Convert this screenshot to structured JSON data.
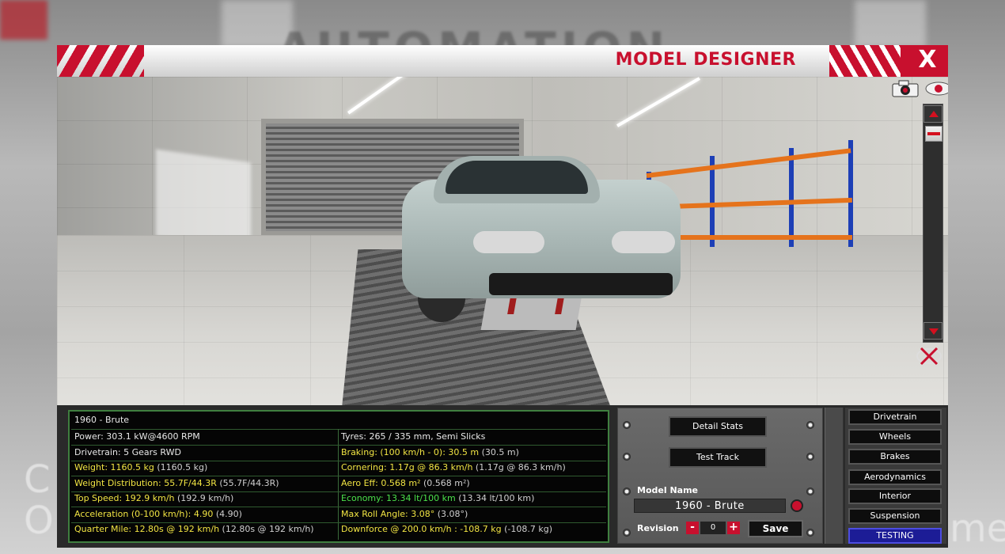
{
  "background": {
    "logo_text": "AUTOMATION",
    "side_left": "C\nO",
    "side_right": "me"
  },
  "window": {
    "title": "MODEL DESIGNER",
    "close_label": "X"
  },
  "stats": {
    "header": "1960 - Brute",
    "left": [
      {
        "label": "Power: 303.1 kW@4600 RPM",
        "extra": "",
        "color": "w"
      },
      {
        "label": "Drivetrain: 5 Gears RWD",
        "extra": "",
        "color": "w"
      },
      {
        "label": "Weight: 1160.5 kg",
        "extra": " (1160.5 kg)",
        "color": "y"
      },
      {
        "label": "Weight Distribution: 55.7F/44.3R",
        "extra": " (55.7F/44.3R)",
        "color": "y"
      },
      {
        "label": "Top Speed: 192.9 km/h",
        "extra": " (192.9 km/h)",
        "color": "y"
      },
      {
        "label": "Acceleration (0-100 km/h): 4.90",
        "extra": " (4.90)",
        "color": "y"
      },
      {
        "label": "Quarter Mile: 12.80s @ 192 km/h",
        "extra": " (12.80s @ 192 km/h)",
        "color": "y"
      }
    ],
    "right": [
      {
        "label": "Tyres: 265 / 335 mm, Semi Slicks",
        "extra": "",
        "color": "w"
      },
      {
        "label": "Braking: (100 km/h - 0): 30.5 m",
        "extra": " (30.5 m)",
        "color": "y"
      },
      {
        "label": "Cornering: 1.17g @ 86.3 km/h",
        "extra": " (1.17g @ 86.3 km/h)",
        "color": "y"
      },
      {
        "label": "Aero Eff: 0.568 m²",
        "extra": " (0.568 m²)",
        "color": "y"
      },
      {
        "label": "Economy: 13.34 lt/100 km",
        "extra": " (13.34 lt/100 km)",
        "color": "g"
      },
      {
        "label": "Max Roll Angle: 3.08°",
        "extra": " (3.08°)",
        "color": "y"
      },
      {
        "label": "Downforce @ 200.0 km/h : -108.7 kg",
        "extra": " (-108.7 kg)",
        "color": "y"
      }
    ]
  },
  "actions": {
    "detail_stats": "Detail Stats",
    "test_track": "Test Track"
  },
  "model": {
    "name_label": "Model Name",
    "name_value": "1960 - Brute",
    "revision_label": "Revision",
    "revision_value": "0",
    "minus": "-",
    "plus": "+",
    "save": "Save"
  },
  "nav": {
    "items": [
      "Drivetrain",
      "Wheels",
      "Brakes",
      "Aerodynamics",
      "Interior",
      "Suspension",
      "TESTING"
    ],
    "active": "TESTING"
  },
  "colors": {
    "accent_red": "#c8102e",
    "stat_yellow": "#f1e443",
    "stat_green": "#4be24b",
    "active_nav": "#1c1c96"
  }
}
